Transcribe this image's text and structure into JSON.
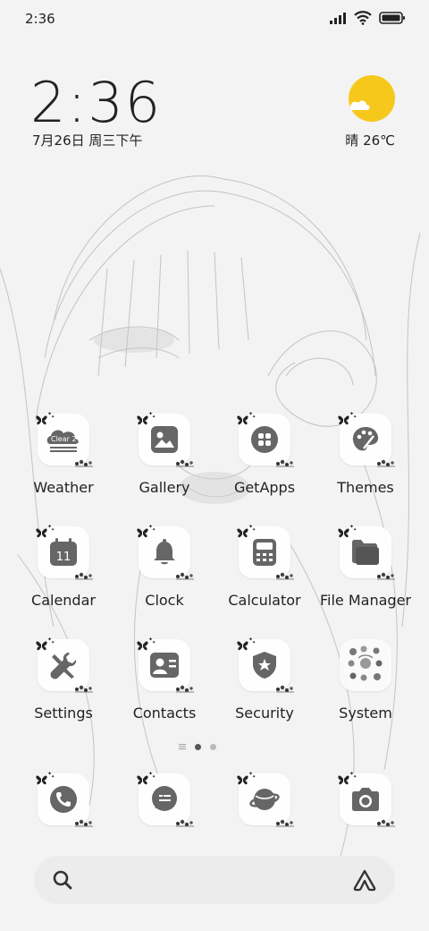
{
  "status_bar": {
    "time": "2:36",
    "icons": [
      "signal-icon",
      "wifi-icon",
      "battery-icon"
    ]
  },
  "lock_widget": {
    "time": "2:36",
    "date": "7月26日 周三下午",
    "weather": "晴 26℃"
  },
  "apps": [
    {
      "label": "Weather",
      "icon": "weather-icon",
      "badge_text": "Clear 2°"
    },
    {
      "label": "Gallery",
      "icon": "gallery-icon"
    },
    {
      "label": "GetApps",
      "icon": "getapps-icon"
    },
    {
      "label": "Themes",
      "icon": "themes-icon"
    },
    {
      "label": "Calendar",
      "icon": "calendar-icon",
      "badge_text": "11"
    },
    {
      "label": "Clock",
      "icon": "bell-icon"
    },
    {
      "label": "Calculator",
      "icon": "calculator-icon"
    },
    {
      "label": "File Manager",
      "icon": "folder-icon"
    },
    {
      "label": "Settings",
      "icon": "wrench-icon"
    },
    {
      "label": "Contacts",
      "icon": "contacts-icon"
    },
    {
      "label": "Security",
      "icon": "shield-icon"
    },
    {
      "label": "System",
      "icon": "system-folder-icon"
    }
  ],
  "dock": [
    {
      "name": "phone",
      "icon": "phone-icon"
    },
    {
      "name": "messages",
      "icon": "message-icon"
    },
    {
      "name": "browser",
      "icon": "planet-icon"
    },
    {
      "name": "camera",
      "icon": "camera-icon"
    }
  ],
  "search": {
    "placeholder": ""
  },
  "colors": {
    "sun": "#f7c81c",
    "icon_gray": "#666666",
    "background": "#f4f4f4"
  }
}
